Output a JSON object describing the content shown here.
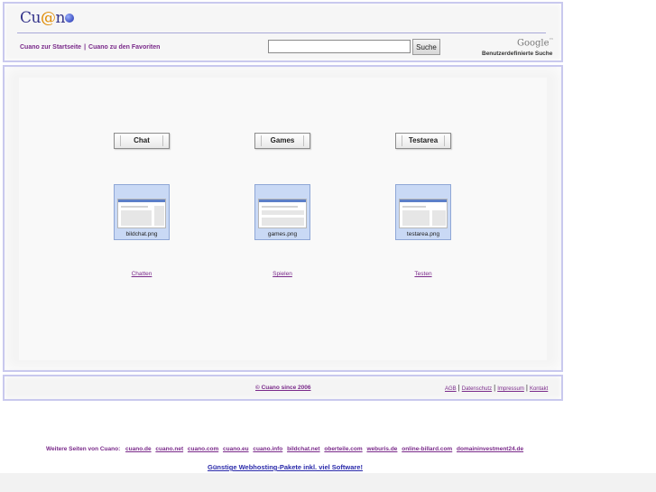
{
  "header": {
    "logo": {
      "c": "Cu",
      "at": "@",
      "n": "n"
    },
    "nav_links": [
      {
        "label": "Cuano zur Startseite"
      },
      {
        "label": "Cuano zu den Favoriten"
      }
    ],
    "nav_separator": "|",
    "search": {
      "placeholder": "",
      "value": "",
      "button_label": "Suche"
    },
    "google_logo": "Google",
    "google_tm": "™",
    "custom_search_label": "Benutzerdefinierte Suche"
  },
  "main": {
    "sections": [
      {
        "button_label": "Chat",
        "thumbnail_caption": "bildchat.png",
        "link_label": "Chatten"
      },
      {
        "button_label": "Games",
        "thumbnail_caption": "games.png",
        "link_label": "Spielen"
      },
      {
        "button_label": "Testarea",
        "thumbnail_caption": "testarea.png",
        "link_label": "Testen"
      }
    ]
  },
  "footer": {
    "copyright": "© Cuano since 2006",
    "links": [
      {
        "label": "AGB"
      },
      {
        "label": "Datenschutz"
      },
      {
        "label": "Impressum"
      },
      {
        "label": "Kontakt"
      }
    ],
    "separator": "|"
  },
  "other_sites": {
    "label": "Weitere Seiten von Cuano:",
    "links": [
      "cuano.de",
      "cuano.net",
      "cuano.com",
      "cuano.eu",
      "cuano.info",
      "bildchat.net",
      "oberteile.com",
      "weburis.de",
      "online-billard.com",
      "domaininvestment24.de"
    ]
  },
  "hosting_link": "Günstige Webhosting-Pakete inkl. viel Software!",
  "colors": {
    "panel_border": "#c9c9ee",
    "link": "#7a2a8a",
    "thumb_bg": "#c9d9f5",
    "hosting_link": "#2a2aaa"
  }
}
